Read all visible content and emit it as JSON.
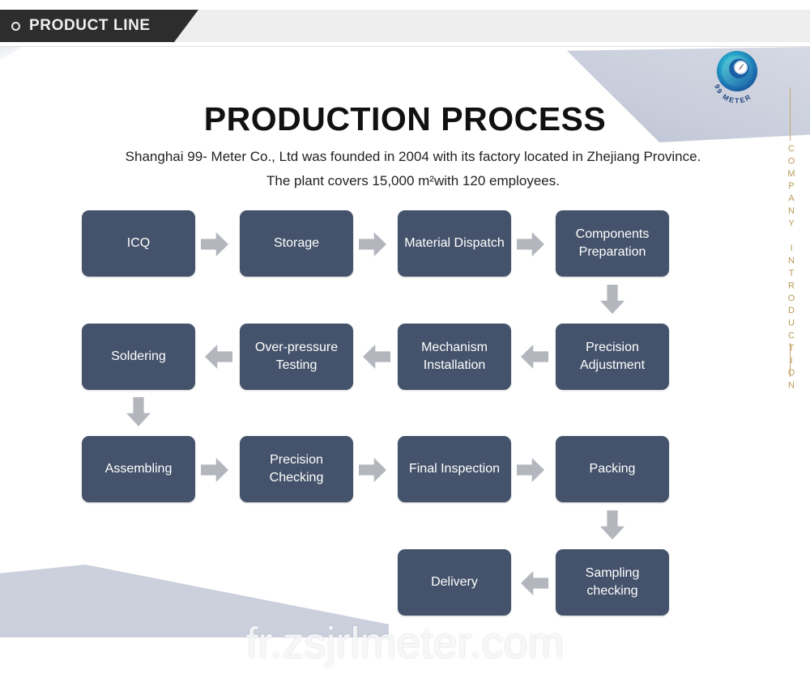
{
  "header": {
    "tag_label": "PRODUCT LINE",
    "bullet_icon": "circle-outline-icon"
  },
  "brand": {
    "logo_icon": "99-meter-swirl-logo",
    "logo_text": "99 METER",
    "vertical_label": "COMPANY INTRODUCTION"
  },
  "main": {
    "title": "PRODUCTION PROCESS",
    "description": "Shanghai 99- Meter Co., Ltd was founded in 2004 with its factory located in Zhejiang Province. The plant covers 15,000 m²with 120 employees."
  },
  "flowchart": {
    "rows": [
      {
        "direction": "right",
        "nodes": [
          "ICQ",
          "Storage",
          "Material Dispatch",
          "Components Preparation"
        ]
      },
      {
        "direction": "left",
        "nodes": [
          "Soldering",
          "Over-pressure Testing",
          "Mechanism Installation",
          "Precision Adjustment"
        ]
      },
      {
        "direction": "right",
        "nodes": [
          "Assembling",
          "Precision Checking",
          "Final Inspection",
          "Packing"
        ]
      },
      {
        "direction": "left",
        "nodes": [
          "Delivery",
          "Sampling checking"
        ]
      }
    ],
    "node_labels": {
      "r1c1": "ICQ",
      "r1c2": "Storage",
      "r1c3": "Material Dispatch",
      "r1c4": "Components Preparation",
      "r2c1": "Soldering",
      "r2c2": "Over-pressure Testing",
      "r2c3": "Mechanism Installation",
      "r2c4": "Precision Adjustment",
      "r3c1": "Assembling",
      "r3c2": "Precision Checking",
      "r3c3": "Final Inspection",
      "r3c4": "Packing",
      "r4c3": "Delivery",
      "r4c4": "Sampling checking"
    }
  },
  "watermark": {
    "text": "fr.zsjrlmeter.com"
  },
  "colors": {
    "node_fill": "#44536b",
    "arrow_fill": "#b3b6bd",
    "header_dark": "#2d2d2d",
    "header_band": "#eeeeee",
    "gold": "#c9a86a",
    "deco_blue_gray": "#ccd0dd"
  }
}
